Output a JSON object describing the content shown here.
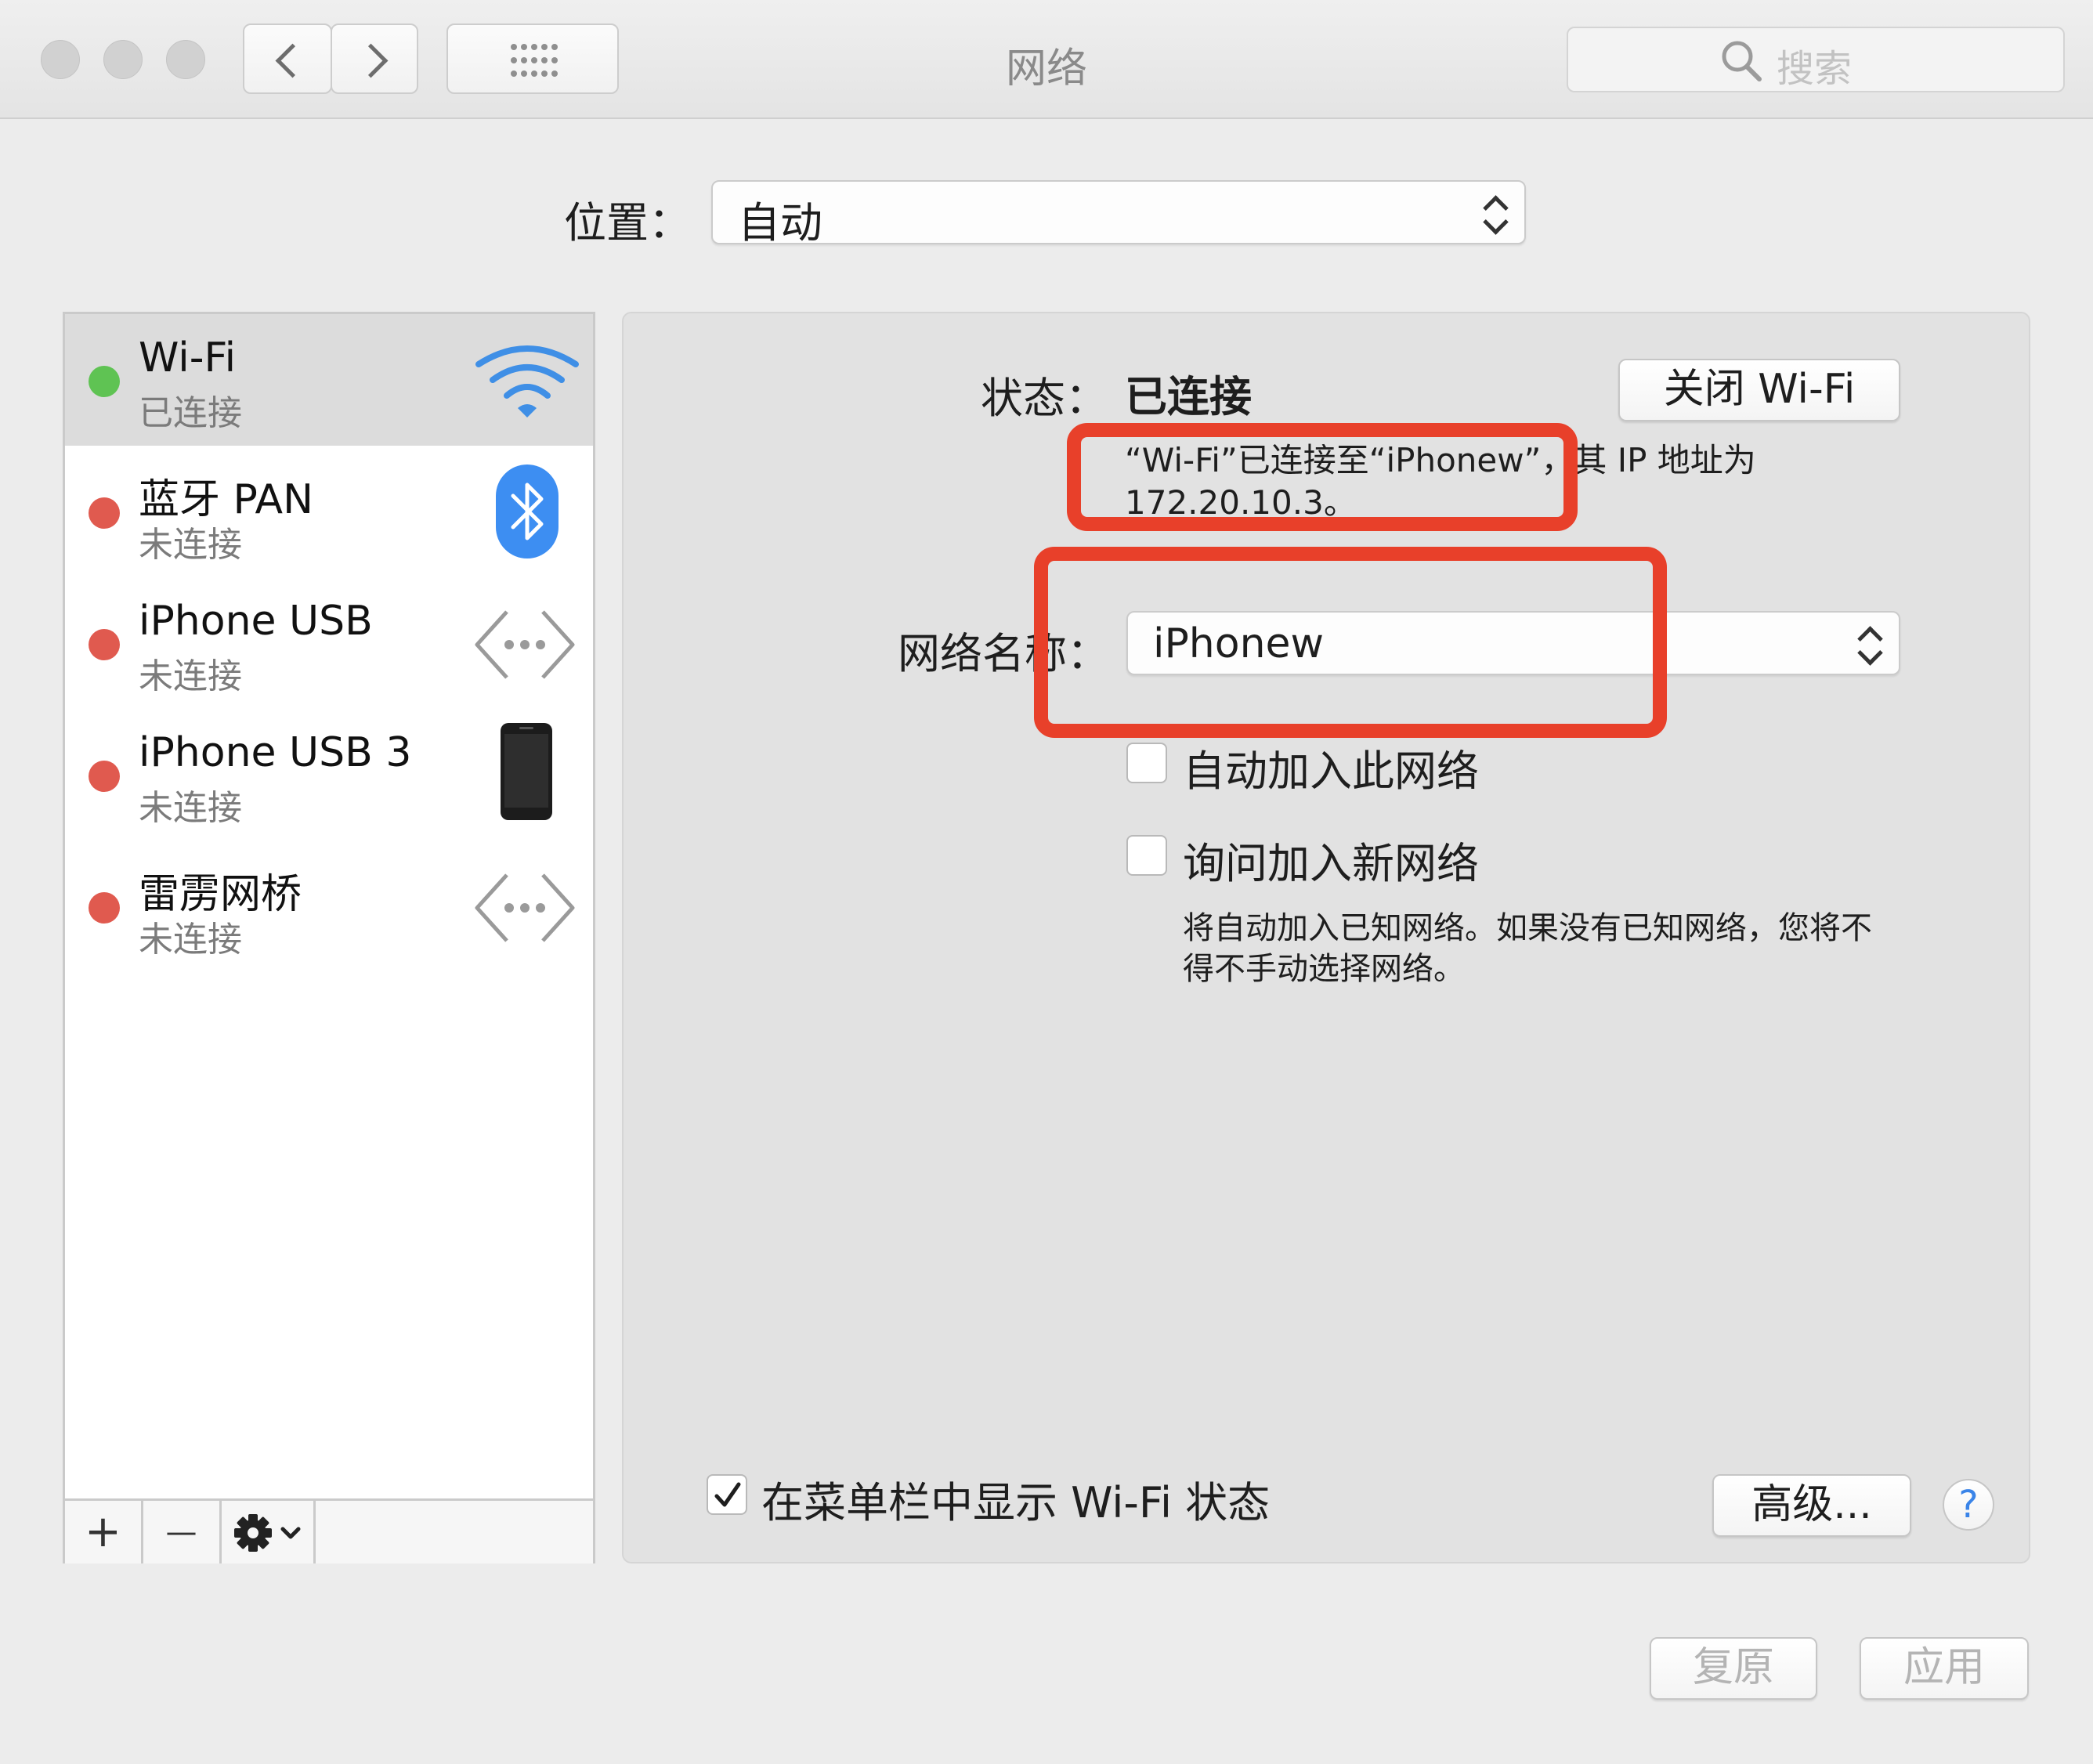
{
  "window": {
    "title": "网络",
    "search_placeholder": "搜索"
  },
  "location": {
    "label": "位置：",
    "value": "自动"
  },
  "services": [
    {
      "name": "Wi-Fi",
      "status": "已连接",
      "dot_color": "#5fc353",
      "icon": "wifi-icon",
      "selected": true
    },
    {
      "name": "蓝牙 PAN",
      "status": "未连接",
      "dot_color": "#e05a4f",
      "icon": "bluetooth-icon"
    },
    {
      "name": "iPhone USB",
      "status": "未连接",
      "dot_color": "#e05a4f",
      "icon": "ethernet-arrows-icon"
    },
    {
      "name": "iPhone USB 3",
      "status": "未连接",
      "dot_color": "#e05a4f",
      "icon": "iphone-icon"
    },
    {
      "name": "雷雳网桥",
      "status": "未连接",
      "dot_color": "#e05a4f",
      "icon": "ethernet-arrows-icon"
    }
  ],
  "sidebar_toolbar": {
    "add": "+",
    "remove": "—"
  },
  "detail": {
    "status_label": "状态：",
    "status_value": "已连接",
    "toggle_button": "关闭 Wi-Fi",
    "status_description_line1": "“Wi-Fi”已连接至“iPhonew”，其 IP 地址为",
    "status_description_line2": "172.20.10.3。",
    "network_name_label": "网络名称：",
    "network_name_value": "iPhonew",
    "auto_join_label": "自动加入此网络",
    "ask_join_label": "询问加入新网络",
    "ask_join_help_line1": "将自动加入已知网络。如果没有已知网络，您将不",
    "ask_join_help_line2": "得不手动选择网络。",
    "show_in_menubar_label": "在菜单栏中显示 Wi-Fi 状态",
    "show_in_menubar_checked": true,
    "advanced_button": "高级...",
    "help_button": "?"
  },
  "footer": {
    "revert_button": "复原",
    "apply_button": "应用"
  },
  "colors": {
    "annotation_red": "#e8402a",
    "connected_green": "#5fc353",
    "disconnected_red": "#e05a4f",
    "bluetooth_blue": "#3d8ef2"
  }
}
